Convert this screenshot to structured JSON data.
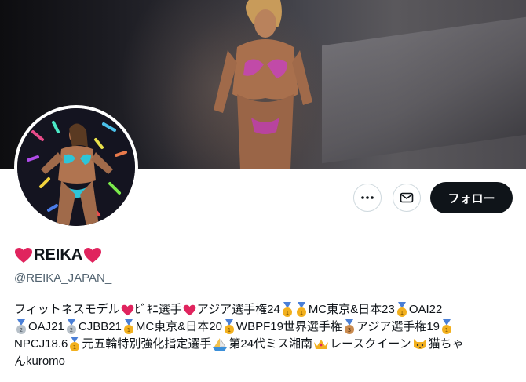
{
  "profile": {
    "display_name": "REIKA",
    "handle": "@REIKA_JAPAN_",
    "follow_label": "フォロー"
  },
  "bio": {
    "line1": [
      "フィットネスモデル",
      "ﾋﾞｷﾆ選手",
      "アジア選手権24",
      "MC東京&日本23",
      "OAI22"
    ],
    "line2": [
      "OAJ21",
      "CJBB21",
      "MC東京&日本20",
      "WBPF19世界選手権",
      "アジア選手権19"
    ],
    "line3": [
      "NPCJ18.6",
      "元五輪特別強化指定選手",
      "第24代ミス湘南",
      "レースクイーン",
      "猫ちゃ"
    ],
    "line4": "んkuromo"
  },
  "icons": {
    "more": "more-horizontal-icon",
    "message": "envelope-icon"
  },
  "colors": {
    "heart": "#e0245e",
    "gold": "#f2b01e",
    "silver": "#b7c0c8",
    "bronze": "#c98a4e",
    "follow_bg": "#0f1419",
    "handle": "#536471"
  }
}
